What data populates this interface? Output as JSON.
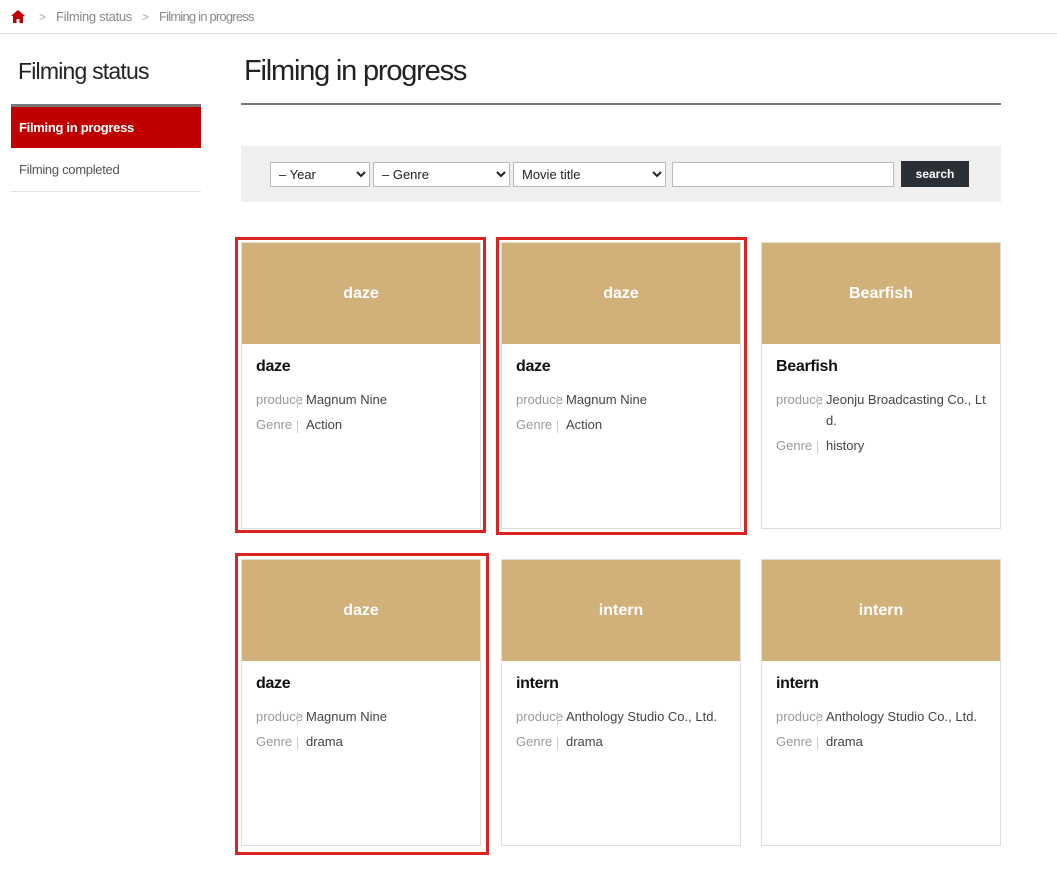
{
  "breadcrumb": {
    "items": [
      "Filming status",
      "Filming in progress"
    ]
  },
  "sidebar": {
    "title": "Filming status",
    "items": [
      {
        "label": "Filming in progress",
        "active": true
      },
      {
        "label": "Filming completed",
        "active": false
      }
    ]
  },
  "main": {
    "title": "Filming in progress"
  },
  "search": {
    "year": "– Year",
    "genre": "– Genre",
    "field": "Movie title",
    "query": "",
    "button": "search"
  },
  "cards": [
    {
      "thumb": "daze",
      "title": "daze",
      "produce_label": "produce",
      "produce": "Magnum Nine",
      "genre_label": "Genre",
      "genre": "Action"
    },
    {
      "thumb": "daze",
      "title": "daze",
      "produce_label": "produce",
      "produce": "Magnum Nine",
      "genre_label": "Genre",
      "genre": "Action"
    },
    {
      "thumb": "Bearfish",
      "title": "Bearfish",
      "produce_label": "produce",
      "produce": "Jeonju Broadcasting Co., Ltd.",
      "genre_label": "Genre",
      "genre": "history"
    },
    {
      "thumb": "daze",
      "title": "daze",
      "produce_label": "produce",
      "produce": "Magnum Nine",
      "genre_label": "Genre",
      "genre": "drama"
    },
    {
      "thumb": "intern",
      "title": "intern",
      "produce_label": "produce",
      "produce": "Anthology Studio Co., Ltd.",
      "genre_label": "Genre",
      "genre": "drama"
    },
    {
      "thumb": "intern",
      "title": "intern",
      "produce_label": "produce",
      "produce": "Anthology Studio Co., Ltd.",
      "genre_label": "Genre",
      "genre": "drama"
    }
  ],
  "colors": {
    "accent": "#c00000",
    "thumb": "#d1b07a",
    "highlight": "#dd2222"
  }
}
